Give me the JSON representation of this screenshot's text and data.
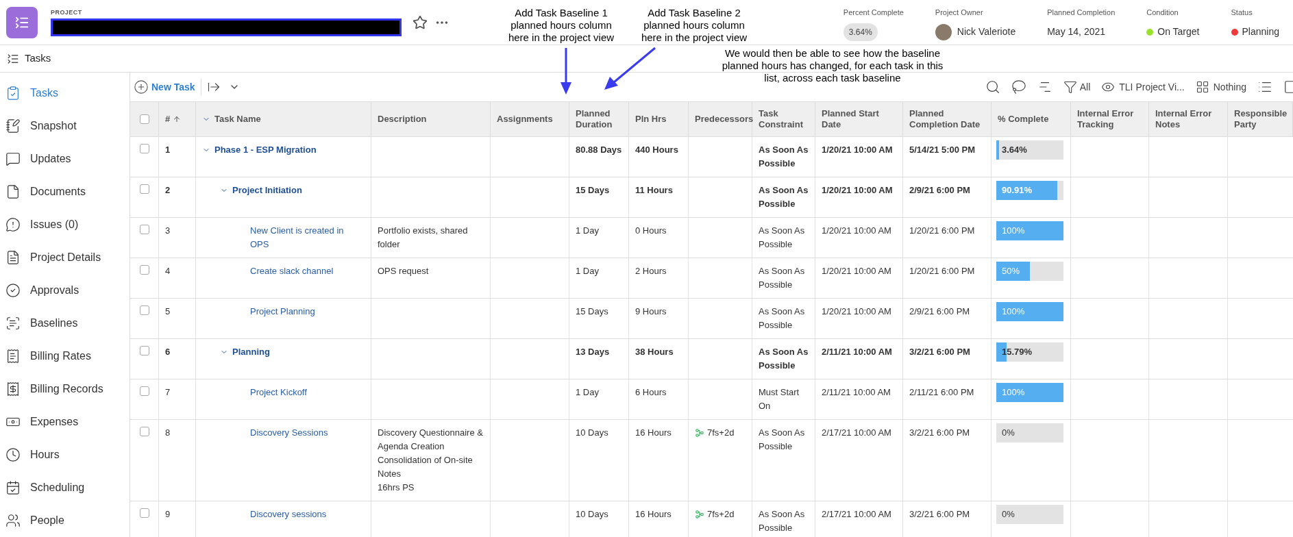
{
  "header": {
    "label": "PROJECT",
    "starred": false,
    "fields": [
      {
        "kind": "pill",
        "label": "Percent Complete",
        "value": "3.64%"
      },
      {
        "kind": "person",
        "label": "Project Owner",
        "value": "Nick Valeriote"
      },
      {
        "kind": "text",
        "label": "Planned Completion",
        "value": "May 14, 2021"
      },
      {
        "kind": "status",
        "label": "Condition",
        "value": "On Target",
        "color": "#9be22d"
      },
      {
        "kind": "status",
        "label": "Status",
        "value": "Planning",
        "color": "#ef3b3b"
      }
    ]
  },
  "section_title": "Tasks",
  "sidebar": {
    "items": [
      {
        "label": "Tasks",
        "selected": true
      },
      {
        "label": "Snapshot",
        "selected": false
      },
      {
        "label": "Updates",
        "selected": false
      },
      {
        "label": "Documents",
        "selected": false
      },
      {
        "label": "Issues (0)",
        "selected": false
      },
      {
        "label": "Project Details",
        "selected": false
      },
      {
        "label": "Approvals",
        "selected": false
      },
      {
        "label": "Baselines",
        "selected": false
      },
      {
        "label": "Billing Rates",
        "selected": false
      },
      {
        "label": "Billing Records",
        "selected": false
      },
      {
        "label": "Expenses",
        "selected": false
      },
      {
        "label": "Hours",
        "selected": false
      },
      {
        "label": "Scheduling",
        "selected": false
      },
      {
        "label": "People",
        "selected": false
      }
    ]
  },
  "toolbar": {
    "new_task": "New Task",
    "filter": "All",
    "view": "TLI Project Vi...",
    "grouping": "Nothing"
  },
  "annotations": [
    {
      "text": "Add Task Baseline 1 planned hours column here in the project view",
      "kind": "down"
    },
    {
      "text": "Add Task Baseline 2 planned hours column here in the project view",
      "kind": "diagonal"
    },
    {
      "text": "We would then be able to see how the baseline planned hours has changed, for each task in this list, across each task baseline",
      "kind": "none"
    }
  ],
  "table": {
    "select_all": false,
    "columns": [
      "#",
      "Task Name",
      "Description",
      "Assignments",
      "Planned Duration",
      "Pln Hrs",
      "Predecessors",
      "Task Constraint",
      "Planned Start Date",
      "Planned Completion Date",
      "% Complete",
      "Internal Error Tracking",
      "Internal Error Notes",
      "Responsible Party"
    ],
    "rows": [
      {
        "kind": "summary",
        "checked": false,
        "expanded": true,
        "number": "1",
        "name": "Phase 1 - ESP Migration",
        "duration": "80.88 Days",
        "hours": "440 Hours",
        "constraint": "As Soon As Possible",
        "start": "1/20/21 10:00 AM",
        "completion": "5/14/21 5:00 PM",
        "percent": "3.64%",
        "level": 0.0364,
        "children": [
          {
            "kind": "summary",
            "checked": false,
            "expanded": true,
            "number": "2",
            "name": "Project Initiation",
            "duration": "15 Days",
            "hours": "11 Hours",
            "constraint": "As Soon As Possible",
            "start": "1/20/21 10:00 AM",
            "completion": "2/9/21 6:00 PM",
            "percent": "90.91%",
            "level": 0.9091,
            "children": [
              {
                "kind": "task",
                "checked": false,
                "number": "3",
                "name": "New Client is created in OPS",
                "description": "Portfolio exists, shared folder",
                "duration": "1 Day",
                "hours": "0 Hours",
                "constraint": "As Soon As Possible",
                "start": "1/20/21 10:00 AM",
                "completion": "1/20/21 6:00 PM",
                "percent": "100%",
                "level": 1
              },
              {
                "kind": "task",
                "checked": false,
                "number": "4",
                "name": "Create slack channel",
                "description": "OPS request",
                "duration": "1 Day",
                "hours": "2 Hours",
                "constraint": "As Soon As Possible",
                "start": "1/20/21 10:00 AM",
                "completion": "1/20/21 6:00 PM",
                "percent": "50%",
                "level": 0.5
              },
              {
                "kind": "task",
                "checked": false,
                "number": "5",
                "name": "Project Planning",
                "duration": "15 Days",
                "hours": "9 Hours",
                "constraint": "As Soon As Possible",
                "start": "1/20/21 10:00 AM",
                "completion": "2/9/21 6:00 PM",
                "percent": "100%",
                "level": 1
              }
            ]
          },
          {
            "kind": "summary",
            "checked": false,
            "expanded": true,
            "number": "6",
            "name": "Planning",
            "duration": "13 Days",
            "hours": "38 Hours",
            "constraint": "As Soon As Possible",
            "start": "2/11/21 10:00 AM",
            "completion": "3/2/21 6:00 PM",
            "percent": "15.79%",
            "level": 0.1579,
            "children": [
              {
                "kind": "task",
                "checked": false,
                "number": "7",
                "name": "Project Kickoff",
                "duration": "1 Day",
                "hours": "6 Hours",
                "constraint": "Must Start On",
                "start": "2/11/21 10:00 AM",
                "completion": "2/11/21 6:00 PM",
                "percent": "100%",
                "level": 1
              },
              {
                "kind": "task",
                "checked": false,
                "number": "8",
                "name": "Discovery Sessions",
                "description": "Discovery Questionnaire & Agenda Creation\nConsolidation of On-site Notes\n16hrs PS",
                "duration": "10 Days",
                "hours": "16 Hours",
                "predecessor": "7fs+2d",
                "constraint": "As Soon As Possible",
                "start": "2/17/21 10:00 AM",
                "completion": "3/2/21 6:00 PM",
                "percent": "0%",
                "level": 0
              },
              {
                "kind": "task",
                "checked": false,
                "number": "9",
                "name": "Discovery sessions",
                "duration": "10 Days",
                "hours": "16 Hours",
                "predecessor": "7fs+2d",
                "constraint": "As Soon As Possible",
                "start": "2/17/21 10:00 AM",
                "completion": "3/2/21 6:00 PM",
                "percent": "0%",
                "level": 0
              }
            ]
          }
        ]
      }
    ]
  }
}
